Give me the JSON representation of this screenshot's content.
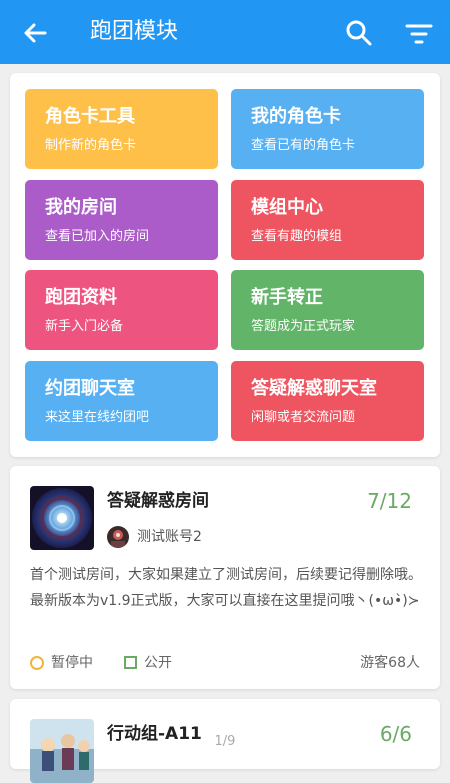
{
  "appbar": {
    "title": "跑团模块",
    "back_icon": "arrow-left-icon",
    "search_icon": "search-icon",
    "filter_icon": "filter-icon",
    "color": "#2196f3"
  },
  "tiles": [
    {
      "title": "角色卡工具",
      "subtitle": "制作新的角色卡",
      "color": "#ffc04a"
    },
    {
      "title": "我的角色卡",
      "subtitle": "查看已有的角色卡",
      "color": "#56b0f2"
    },
    {
      "title": "我的房间",
      "subtitle": "查看已加入的房间",
      "color": "#ac5cc8"
    },
    {
      "title": "模组中心",
      "subtitle": "查看有趣的模组",
      "color": "#ee5560"
    },
    {
      "title": "跑团资料",
      "subtitle": "新手入门必备",
      "color": "#ee5480"
    },
    {
      "title": "新手转正",
      "subtitle": "答题成为正式玩家",
      "color": "#62b468"
    },
    {
      "title": "约团聊天室",
      "subtitle": "来这里在线约团吧",
      "color": "#56b0f2"
    },
    {
      "title": "答疑解惑聊天室",
      "subtitle": "闲聊或者交流问题",
      "color": "#ee5560"
    }
  ],
  "rooms": [
    {
      "name": "答疑解惑房间",
      "count": "7/12",
      "owner": "测试账号2",
      "description": "首个测试房间，大家如果建立了测试房间，后续要记得删除哦。最新版本为v1.9正式版，大家可以直接在这里提问哦丶(•ω•̀)≻",
      "status": "暂停中",
      "visibility": "公开",
      "visitors": "游客68人"
    },
    {
      "name": "行动组-A11",
      "count": "6/6"
    }
  ],
  "pager": {
    "text": "1/9"
  }
}
